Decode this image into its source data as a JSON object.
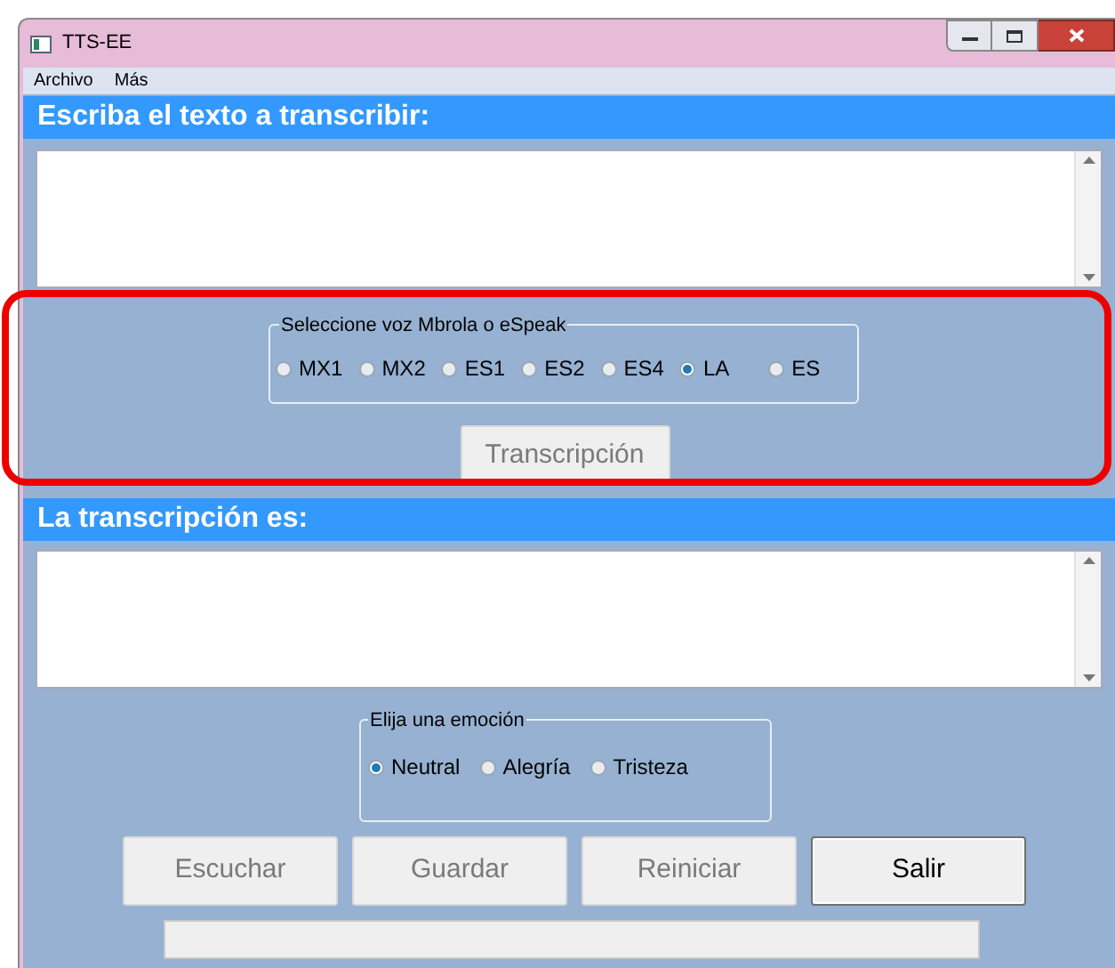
{
  "window": {
    "title": "TTS-EE"
  },
  "menu": [
    {
      "label": "Archivo"
    },
    {
      "label": "Más"
    }
  ],
  "input_section": {
    "heading": "Escriba el texto a transcribir:"
  },
  "voice_group": {
    "legend": "Seleccione voz Mbrola o eSpeak",
    "options": [
      {
        "label": "MX1",
        "selected": false
      },
      {
        "label": "MX2",
        "selected": false
      },
      {
        "label": "ES1",
        "selected": false
      },
      {
        "label": "ES2",
        "selected": false
      },
      {
        "label": "ES4",
        "selected": false
      },
      {
        "label": "LA",
        "selected": true
      },
      {
        "label": "ES",
        "selected": false
      }
    ]
  },
  "transcribe_button": {
    "label": "Transcripción",
    "disabled": true
  },
  "output_section": {
    "heading": "La transcripción es:"
  },
  "emotion_group": {
    "legend": "Elija una emoción",
    "options": [
      {
        "label": "Neutral",
        "selected": true
      },
      {
        "label": "Alegría",
        "selected": false
      },
      {
        "label": "Tristeza",
        "selected": false
      }
    ]
  },
  "buttons": [
    {
      "label": "Escuchar",
      "disabled": true
    },
    {
      "label": "Guardar",
      "disabled": true
    },
    {
      "label": "Reiniciar",
      "disabled": true
    },
    {
      "label": "Salir",
      "disabled": false
    }
  ],
  "progress": {
    "level": 0
  }
}
